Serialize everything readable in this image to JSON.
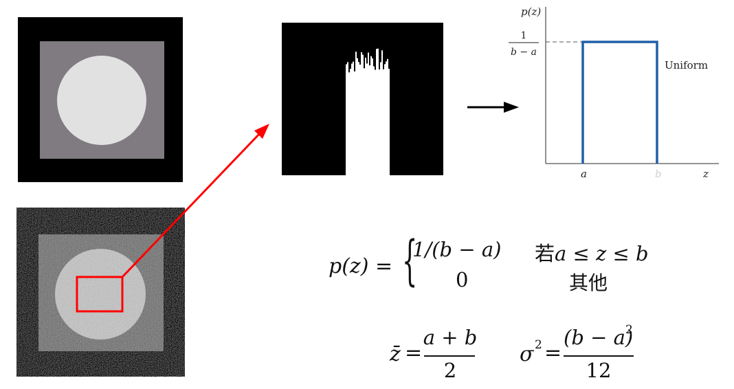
{
  "uniform_plot": {
    "y_label": "p(z)",
    "level_num": "1",
    "level_den": "b − a",
    "curve_label": "Uniform",
    "tick_a": "a",
    "tick_b": "b",
    "x_label": "z"
  },
  "pdf_formula": {
    "lhs": "p(z) =",
    "case1_value": "1/(b − a)",
    "case1_condition_prefix": "若",
    "case1_condition": "a ≤ z ≤ b",
    "case2_value": "0",
    "case2_condition": "其他"
  },
  "mean_formula": {
    "lhs": "z̄",
    "eq": "=",
    "numerator": "a + b",
    "denominator": "2"
  },
  "variance_formula": {
    "lhs": "σ",
    "lhs_sup": "2",
    "eq": "=",
    "numerator": "(b − a)",
    "numerator_sup": "2",
    "denominator": "12"
  },
  "colors": {
    "red_arrow": "#ff0000",
    "uniform_line": "#1f5fa8",
    "gray_square": "#7f7b80",
    "light_circle": "#e1e1e1"
  }
}
